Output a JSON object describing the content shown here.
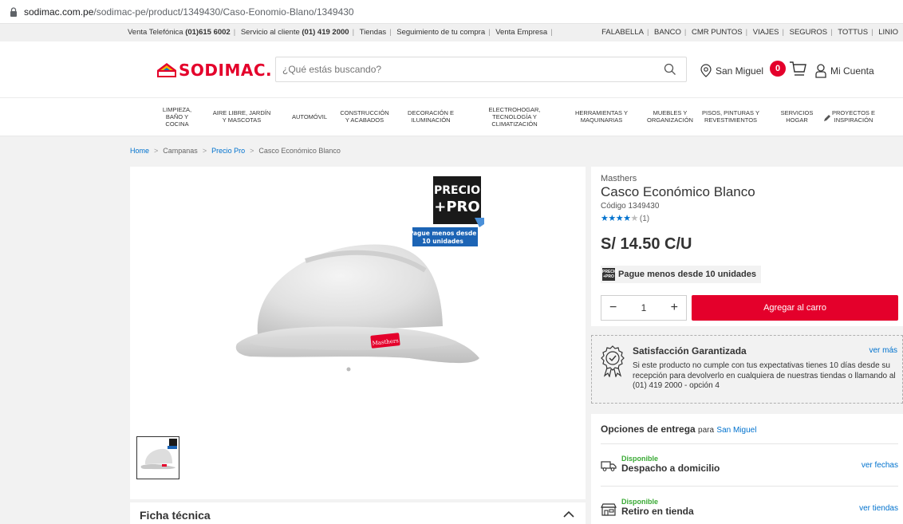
{
  "browser": {
    "url_domain": "sodimac.com.pe",
    "url_path": "/sodimac-pe/product/1349430/Caso-Eonomio-Blano/1349430"
  },
  "topbar": {
    "left": [
      {
        "pre": "Venta Telefónica ",
        "bold": "(01)615 6002"
      },
      {
        "pre": "Servicio al cliente ",
        "bold": "(01) 419 2000"
      },
      {
        "pre": "Tiendas",
        "bold": ""
      },
      {
        "pre": "Seguimiento de tu compra",
        "bold": ""
      },
      {
        "pre": "Venta Empresa",
        "bold": ""
      }
    ],
    "right": [
      "FALABELLA",
      "BANCO",
      "CMR PUNTOS",
      "VIAJES",
      "SEGUROS",
      "TOTTUS",
      "LINIO"
    ]
  },
  "header": {
    "logo_text": "SODIMAC.",
    "search_placeholder": "¿Qué estás buscando?",
    "location": "San Miguel",
    "cart_count": "0",
    "account": "Mi Cuenta"
  },
  "categories": [
    "LIMPIEZA,\nBAÑO Y\nCOCINA",
    "AIRE LIBRE, JARDÍN\nY MASCOTAS",
    "AUTOMÓVIL",
    "CONSTRUCCIÓN\nY ACABADOS",
    "DECORACIÓN E\nILUMINACIÓN",
    "ELECTROHOGAR,\nTECNOLOGÍA Y\nCLIMATIZACIÓN",
    "HERRAMIENTAS Y\nMAQUINARIAS",
    "MUEBLES Y\nORGANIZACIÓN",
    "PISOS, PINTURAS Y\nREVESTIMIENTOS",
    "SERVICIOS\nHOGAR",
    "PROYECTOS E\nINSPIRACIÓN"
  ],
  "breadcrumb": [
    "Home",
    "Campanas",
    "Precio Pro",
    "Casco Económico Blanco"
  ],
  "badge": {
    "line1": "PRECIO",
    "line2": "+PRO",
    "caption1": "Pague menos desde",
    "caption2": "10 unidades"
  },
  "helmet_logo": "Masthers",
  "product": {
    "brand": "Masthers",
    "title": "Casco Económico Blanco",
    "code": "Código 1349430",
    "rating": 4,
    "rating_max": 5,
    "reviews": "(1)",
    "price": "S/ 14.50 C/U",
    "promo": "Pague menos desde 10 unidades",
    "promo_mini_1": "PRECIO",
    "promo_mini_2": "+PRO",
    "quantity": "1",
    "qty_minus": "−",
    "qty_plus": "+",
    "add_to_cart": "Agregar al carro"
  },
  "satisfaction": {
    "title": "Satisfacción Garantizada",
    "link": "ver más",
    "text": "Si este producto no cumple con tus expectativas tienes 10 días desde su recepción para devolverlo en cualquiera de nuestras tiendas o llamando al (01) 419 2000 - opción 4"
  },
  "delivery": {
    "title": "Opciones de entrega",
    "para": "para",
    "location": "San Miguel",
    "options": [
      {
        "status": "Disponible",
        "label": "Despacho a domicilio",
        "link": "ver fechas",
        "icon": "truck-icon"
      },
      {
        "status": "Disponible",
        "label": "Retiro en tienda",
        "link": "ver tiendas",
        "icon": "store-icon"
      }
    ]
  },
  "ficha": {
    "title": "Ficha técnica"
  },
  "colors": {
    "brand_red": "#e4002b",
    "link_blue": "#0072ce",
    "available_green": "#3aaa35"
  }
}
